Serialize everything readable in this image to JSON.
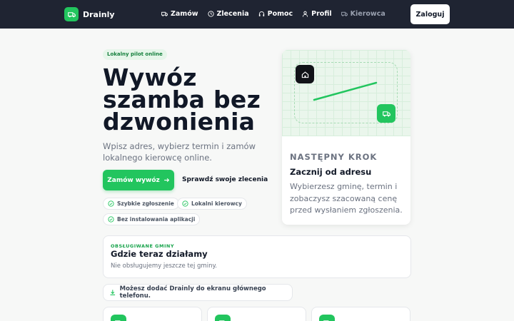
{
  "app": {
    "name": "Drainly",
    "logo_icon": "truck-icon",
    "accent": "#22c55e",
    "header_bg": "#1f2432"
  },
  "nav": {
    "items": [
      {
        "label": "Zamów",
        "icon": "truck-icon"
      },
      {
        "label": "Zlecenia",
        "icon": "clock-icon"
      },
      {
        "label": "Pomoc",
        "icon": "headset-icon"
      },
      {
        "label": "Profil",
        "icon": "user-icon"
      },
      {
        "label": "Kierowca",
        "icon": "truck-icon"
      }
    ],
    "login_label": "Zaloguj"
  },
  "hero": {
    "pill": "Lokalny pilot online",
    "title": "Wywóz szamba bez dzwonienia",
    "subtitle": "Wpisz adres, wybierz termin i zamów lokalnego kierowcę online.",
    "cta_label": "Zamów wywóz",
    "secondary_label": "Sprawdź swoje zlecenia",
    "chips": [
      "Szybkie zgłoszenie",
      "Lokalni kierowcy",
      "Bez instalowania aplikacji"
    ]
  },
  "next_step": {
    "kicker": "NASTĘPNY KROK",
    "title": "Zacznij od adresu",
    "body": "Wybierzesz gminę, termin i zobaczysz szacowaną cenę przed wysłaniem zgłoszenia."
  },
  "areas": {
    "kicker": "OBSŁUGIWANE GMINY",
    "title": "Gdzie teraz działamy",
    "empty": "Nie obsługujemy jeszcze tej gminy."
  },
  "install_hint": "Możesz dodać Drainly do ekranu głównego telefonu."
}
